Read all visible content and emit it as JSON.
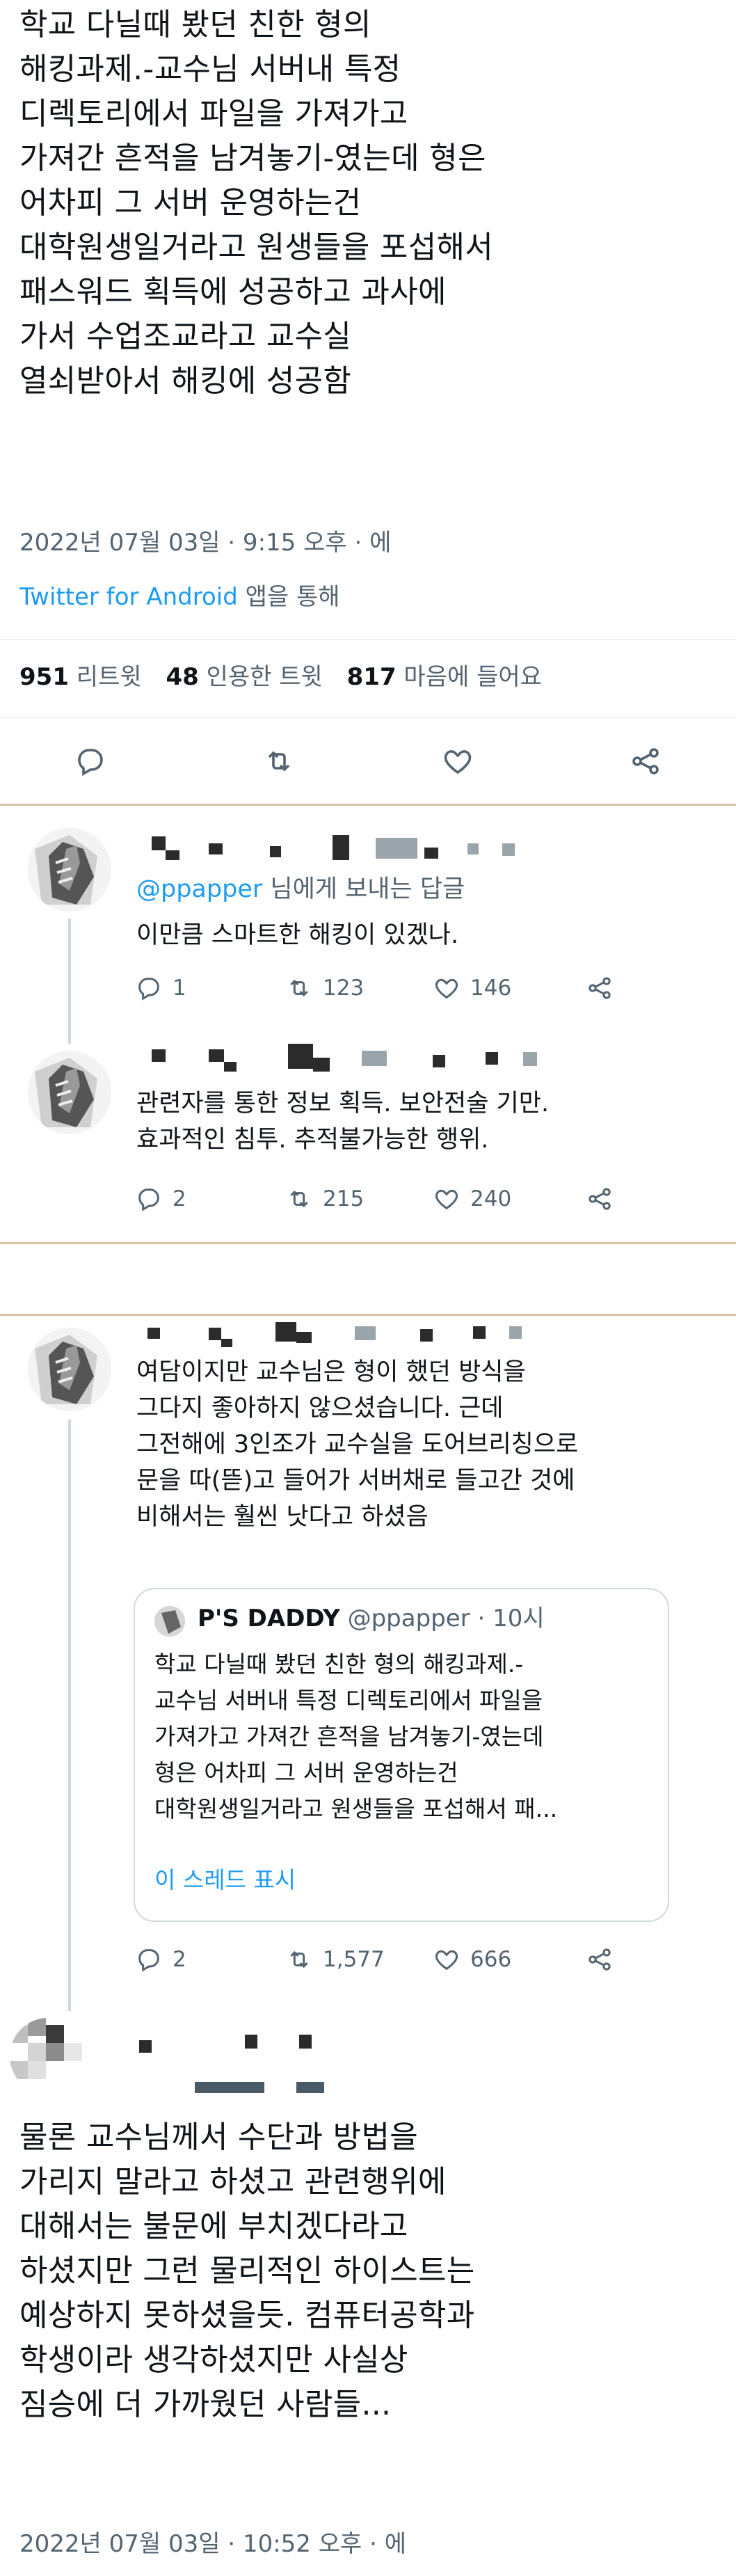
{
  "main_tweet": {
    "lines": [
      "학교 다닐때 봤던 친한 형의",
      "해킹과제.-교수님 서버내 특정",
      "디렉토리에서 파일을 가져가고",
      "가져간 흔적을 남겨놓기-였는데 형은",
      "어차피 그 서버 운영하는건",
      "대학원생일거라고 원생들을 포섭해서",
      "패스워드 획득에 성공하고 과사에",
      "가서 수업조교라고 교수실",
      "열쇠받아서 해킹에 성공함"
    ],
    "timestamp": "2022년 07월 03일 · 9:15 오후 · 에",
    "source": "Twitter for Android",
    "source_suffix": " 앱을 통해",
    "retweets": "951",
    "retweets_label": "리트윗",
    "quotes": "48",
    "quotes_label": "인용한 트윗",
    "likes": "817",
    "likes_label": "마음에 들어요"
  },
  "reply1": {
    "reply_to_prefix": "@ppapper",
    "reply_to_suffix": " 님에게 보내는 답글",
    "text": "이만큼 스마트한 해킹이 있겠나.",
    "replies": "1",
    "retweets": "123",
    "likes": "146"
  },
  "reply2": {
    "text_lines": [
      "관련자를 통한 정보 획득. 보안전술 기만.",
      "효과적인 침투. 추적불가능한 행위."
    ],
    "replies": "2",
    "retweets": "215",
    "likes": "240"
  },
  "reply3": {
    "text_lines": [
      "여담이지만 교수님은 형이 했던 방식을",
      "그다지 좋아하지 않으셨습니다. 근데",
      "그전해에 3인조가 교수실을 도어브리칭으로",
      "문을 따(뜯)고 들어가 서버채로 들고간 것에",
      "비해서는 훨씬 낫다고 하셨음"
    ],
    "quote": {
      "name": "P'S DADDY",
      "handle": "@ppapper",
      "time": "· 10시",
      "lines": [
        "학교 다닐때 봤던 친한 형의 해킹과제.-",
        "교수님 서버내 특정 디렉토리에서 파일을",
        "가져가고 가져간 흔적을 남겨놓기-였는데",
        "형은 어차피 그 서버 운영하는건",
        "대학원생일거라고 원생들을 포섭해서 패..."
      ],
      "show_thread": "이 스레드 표시"
    },
    "replies": "2",
    "retweets": "1,577",
    "likes": "666"
  },
  "final_tweet": {
    "lines": [
      "물론 교수님께서 수단과 방법을",
      "가리지 말라고 하셨고 관련행위에",
      "대해서는 불문에 부치겠다라고",
      "하셨지만 그런 물리적인 하이스트는",
      "예상하지 못하셨을듯. 컴퓨터공학과",
      "학생이라 생각하셨지만 사실상",
      "짐승에 더 가까웠던 사람들..."
    ],
    "timestamp": "2022년 07월 03일 · 10:52 오후 · 에"
  },
  "icons": {
    "reply": "reply-icon",
    "retweet": "retweet-icon",
    "like": "heart-icon",
    "share": "share-icon",
    "avatar": "avatar"
  },
  "colors": {
    "link": "#1d9bf0",
    "muted": "#536471",
    "divider": "#d9c3a8"
  }
}
